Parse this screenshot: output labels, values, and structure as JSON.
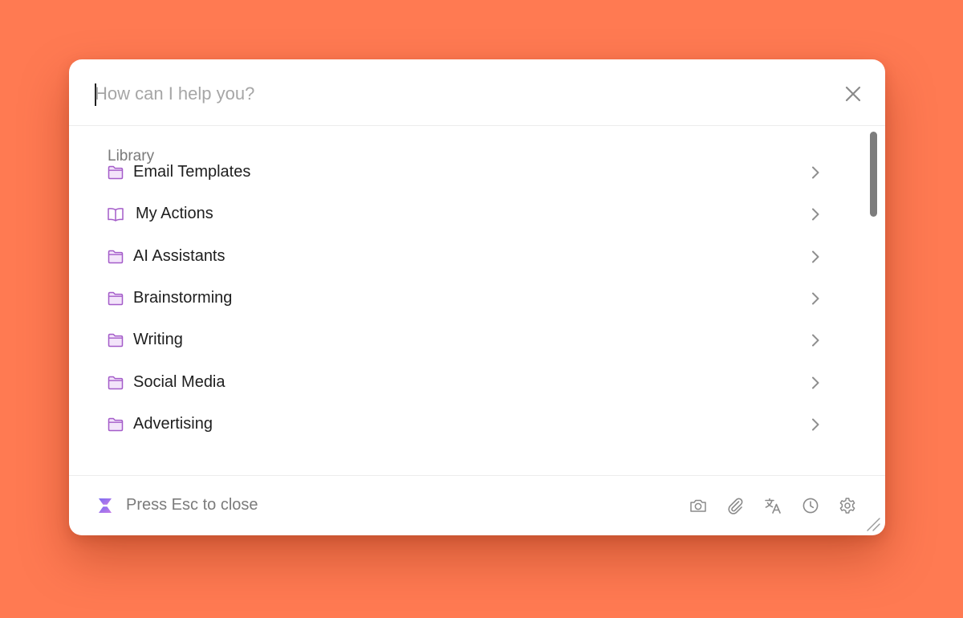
{
  "search": {
    "placeholder": "How can I help you?",
    "value": ""
  },
  "library": {
    "title": "Library",
    "items": [
      {
        "label": "Email Templates",
        "icon": "folder-icon"
      },
      {
        "label": "My Actions",
        "icon": "book-icon"
      },
      {
        "label": "AI Assistants",
        "icon": "folder-icon"
      },
      {
        "label": "Brainstorming",
        "icon": "folder-icon"
      },
      {
        "label": "Writing",
        "icon": "folder-icon"
      },
      {
        "label": "Social Media",
        "icon": "folder-icon"
      },
      {
        "label": "Advertising",
        "icon": "folder-icon"
      }
    ]
  },
  "footer": {
    "hint": "Press Esc to close",
    "tools": [
      "camera-icon",
      "paperclip-icon",
      "translate-icon",
      "history-icon",
      "settings-icon"
    ]
  },
  "colors": {
    "background": "#FF7A52",
    "accent": "#A45CC9",
    "folder_fill": "#F3E4FA"
  }
}
